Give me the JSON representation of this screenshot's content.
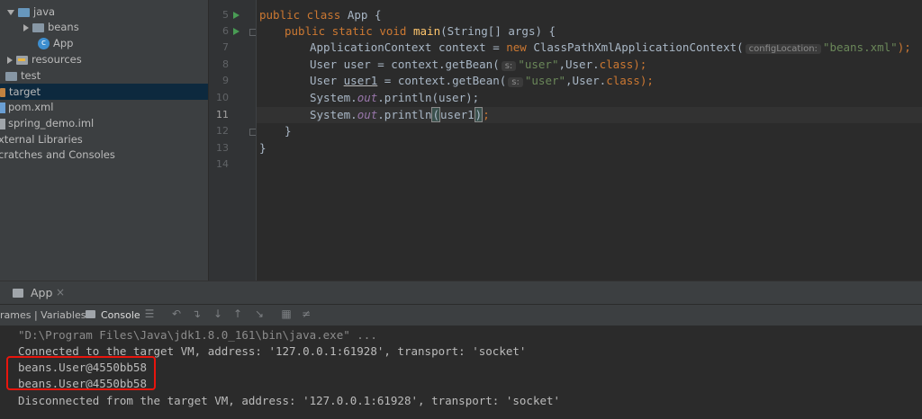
{
  "project_tree": {
    "items": [
      {
        "label": "java"
      },
      {
        "label": "beans"
      },
      {
        "label": "App"
      },
      {
        "label": "resources"
      },
      {
        "label": "test"
      },
      {
        "label": "target"
      },
      {
        "label": "pom.xml"
      },
      {
        "label": "spring_demo.iml"
      },
      {
        "label": "xternal Libraries"
      },
      {
        "label": "cratches and Consoles"
      }
    ]
  },
  "editor": {
    "line_numbers": [
      "5",
      "6",
      "7",
      "8",
      "9",
      "10",
      "11",
      "12",
      "13",
      "14"
    ],
    "code": {
      "l5_kw": "public class ",
      "l5_rest": "App {",
      "l6_kw": "public static void ",
      "l6_fn": "main",
      "l6_rest": "(String[] args) {",
      "l7_a": "ApplicationContext context = ",
      "l7_kw": "new ",
      "l7_b": "ClassPathXmlApplicationContext(",
      "l7_hint": "configLocation:",
      "l7_str": "\"beans.xml\"",
      "l7_c": ");",
      "l8_a": "User user = context.getBean(",
      "l8_hint": "s:",
      "l8_str": "\"user\"",
      "l8_b": ",User.",
      "l8_kw": "class",
      "l8_c": ");",
      "l9_a": "User ",
      "l9_var": "user1",
      "l9_b": " = context.getBean(",
      "l9_hint": "s:",
      "l9_str": "\"user\"",
      "l9_c": ",User.",
      "l9_kw": "class",
      "l9_d": ");",
      "l10_a": "System.",
      "l10_st": "out",
      "l10_b": ".println(user);",
      "l11_a": "System.",
      "l11_st": "out",
      "l11_b": ".println",
      "l11_paren1": "(",
      "l11_c": "user1",
      "l11_paren2": ")",
      "l11_d": ";",
      "l12": "}",
      "l13": "}"
    }
  },
  "run_panel": {
    "title": "App",
    "close": "×",
    "tab_frames": "rames | Variables",
    "tab_console": "Console",
    "output": [
      "\"D:\\Program Files\\Java\\jdk1.8.0_161\\bin\\java.exe\" ...",
      "Connected to the target VM, address: '127.0.0.1:61928', transport: 'socket'",
      "beans.User@4550bb58",
      "beans.User@4550bb58",
      "Disconnected from the target VM, address: '127.0.0.1:61928', transport: 'socket'"
    ]
  },
  "colors": {
    "accent_highlight": "#e8150d",
    "keyword": "#cc7832",
    "string": "#6a8759",
    "function": "#ffc66d"
  }
}
